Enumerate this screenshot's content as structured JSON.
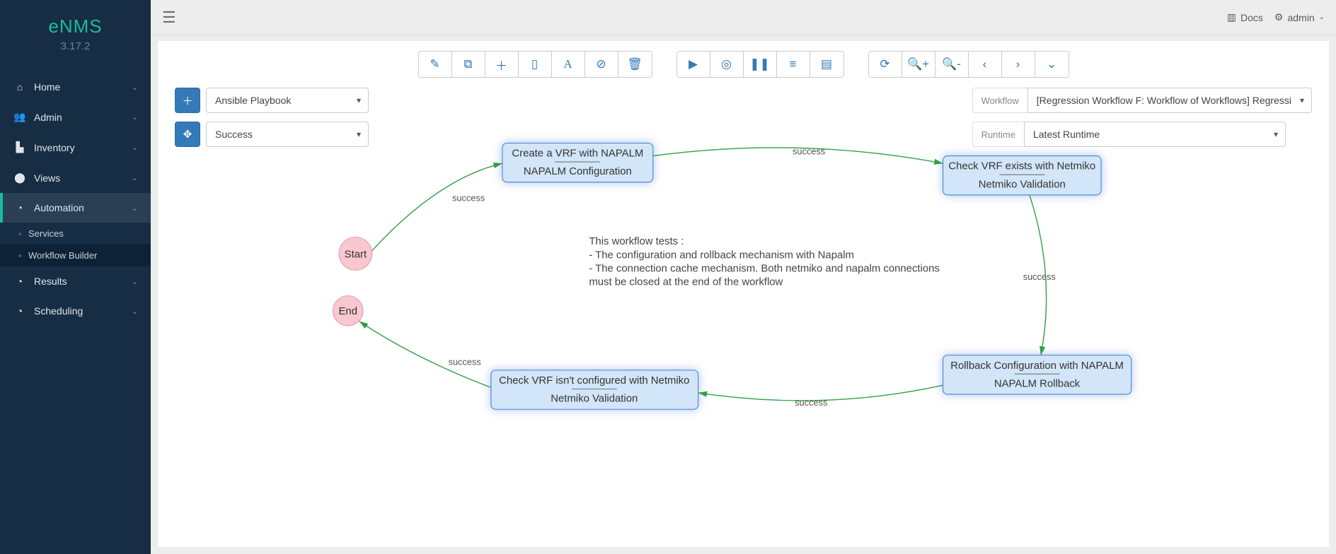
{
  "app": {
    "name": "eNMS",
    "version": "3.17.2"
  },
  "topbar": {
    "docs": "Docs",
    "user": "admin"
  },
  "sidebar": {
    "items": [
      {
        "label": "Home"
      },
      {
        "label": "Admin"
      },
      {
        "label": "Inventory"
      },
      {
        "label": "Views"
      },
      {
        "label": "Automation"
      },
      {
        "label": "Results"
      },
      {
        "label": "Scheduling"
      }
    ],
    "automation_sub": [
      {
        "label": "Services"
      },
      {
        "label": "Workflow Builder"
      }
    ]
  },
  "controls": {
    "service_type": "Ansible Playbook",
    "edge_mode": "Success",
    "workflow_label": "Workflow",
    "workflow_value": "[Regression Workflow F: Workflow of Workflows] Regressi",
    "runtime_label": "Runtime",
    "runtime_value": "Latest Runtime"
  },
  "diagram": {
    "description_lines": [
      "This workflow tests :",
      "- The configuration and rollback mechanism with Napalm",
      "- The connection cache mechanism. Both netmiko and napalm connections",
      "must be closed at the end of the workflow"
    ],
    "start": "Start",
    "end": "End",
    "nodes": {
      "n1": {
        "title": "Create a VRF with NAPALM",
        "subtitle": "NAPALM Configuration"
      },
      "n2": {
        "title": "Check VRF exists with Netmiko",
        "subtitle": "Netmiko Validation"
      },
      "n3": {
        "title": "Rollback Configuration with NAPALM",
        "subtitle": "NAPALM Rollback"
      },
      "n4": {
        "title": "Check VRF isn't configured with Netmiko",
        "subtitle": "Netmiko Validation"
      }
    },
    "edge_label": "success"
  }
}
